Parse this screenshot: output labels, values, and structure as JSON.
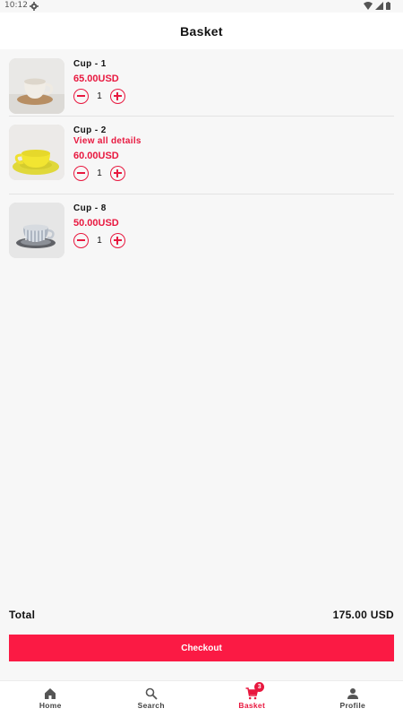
{
  "status_bar": {
    "time": "10:12"
  },
  "header": {
    "title": "Basket"
  },
  "basket": {
    "items": [
      {
        "name": "Cup - 1",
        "price": "65.00USD",
        "quantity": "1"
      },
      {
        "name": "Cup - 2",
        "details_link": "View all details",
        "price": "60.00USD",
        "quantity": "1"
      },
      {
        "name": "Cup - 8",
        "price": "50.00USD",
        "quantity": "1"
      }
    ]
  },
  "summary": {
    "total_label": "Total",
    "total_value": "175.00 USD"
  },
  "checkout_label": "Checkout",
  "bottom_nav": {
    "items": [
      {
        "label": "Home",
        "icon": "home-icon"
      },
      {
        "label": "Search",
        "icon": "search-icon"
      },
      {
        "label": "Basket",
        "icon": "cart-icon",
        "badge": "3",
        "active": true
      },
      {
        "label": "Profile",
        "icon": "person-icon"
      }
    ]
  },
  "colors": {
    "accent": "#e8183f",
    "checkout": "#fb1a44",
    "background": "#f7f7f7"
  }
}
